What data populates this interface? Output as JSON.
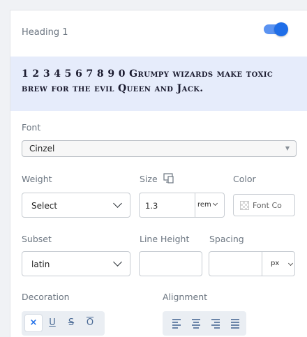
{
  "header": {
    "title": "Heading 1",
    "toggle_on": true
  },
  "preview": {
    "text": "1 2 3 4 5 6 7 8 9 0 Grumpy wizards make toxic brew for the evil Queen and Jack."
  },
  "font": {
    "label": "Font",
    "value": "Cinzel"
  },
  "weight": {
    "label": "Weight",
    "value": "Select"
  },
  "size": {
    "label": "Size",
    "value": "1.3",
    "unit": "rem"
  },
  "color": {
    "label": "Color",
    "button_label": "Font Co"
  },
  "subset": {
    "label": "Subset",
    "value": "latin"
  },
  "line_height": {
    "label": "Line Height",
    "value": ""
  },
  "spacing": {
    "label": "Spacing",
    "value": "",
    "unit": "px"
  },
  "decoration": {
    "label": "Decoration",
    "options": [
      "×",
      "U",
      "S",
      "O"
    ],
    "active": 0
  },
  "alignment": {
    "label": "Alignment",
    "options": [
      "align-left",
      "align-center",
      "align-right",
      "align-justify"
    ]
  },
  "colors": {
    "accent": "#1f6ee8",
    "preview_bg": "#e6ecfb"
  }
}
